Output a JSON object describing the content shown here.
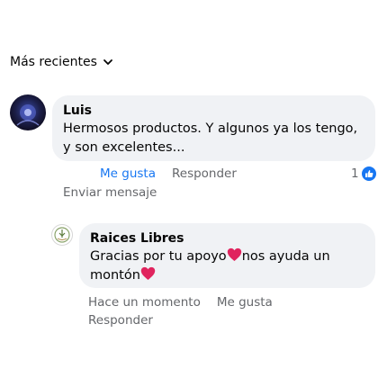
{
  "sort": {
    "label": "Más recientes"
  },
  "comments": [
    {
      "author": "Luis",
      "text": "Hermosos productos. Y algunos ya los tengo, y son excelentes...",
      "like_label": "Me gusta",
      "reply_label": "Responder",
      "send_message_label": "Enviar mensaje",
      "reaction_count": "1"
    },
    {
      "author": "Raices Libres",
      "text_part1": "Gracias por tu apoyo",
      "text_part2": "nos ayuda un montón",
      "time": "Hace un momento",
      "like_label": "Me gusta",
      "reply_label": "Responder"
    }
  ],
  "colors": {
    "accent": "#1877f2",
    "bubble": "#f0f2f5",
    "muted": "#65676b",
    "heart": "#e0245e"
  },
  "icons": [
    "chevron-down-icon",
    "like-thumb-icon",
    "heart-icon"
  ]
}
